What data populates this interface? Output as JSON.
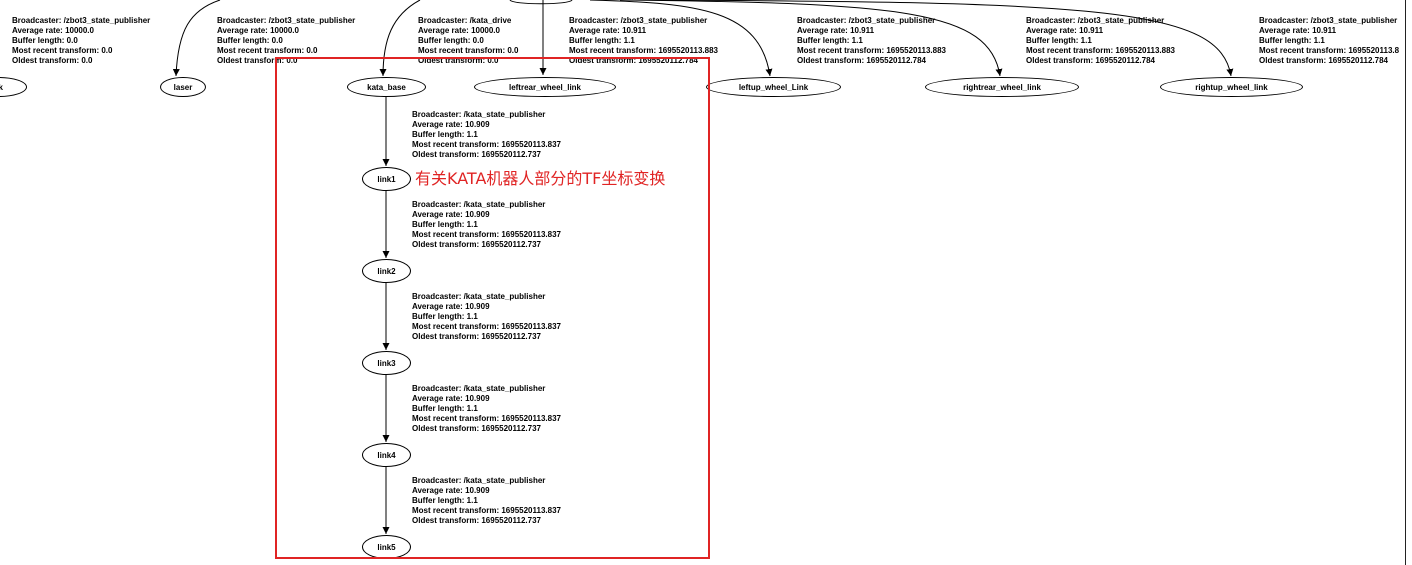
{
  "annotation": "有关KATA机器人部分的TF坐标变换",
  "top_row": {
    "labels": [
      {
        "broadcaster": "Broadcaster: /zbot3_state_publisher",
        "rate": "Average rate: 10000.0",
        "buffer": "Buffer length: 0.0",
        "recent": "Most recent transform: 0.0",
        "oldest": "Oldest transform: 0.0"
      },
      {
        "broadcaster": "Broadcaster: /zbot3_state_publisher",
        "rate": "Average rate: 10000.0",
        "buffer": "Buffer length: 0.0",
        "recent": "Most recent transform: 0.0",
        "oldest": "Oldest transform: 0.0"
      },
      {
        "broadcaster": "Broadcaster: /kata_drive",
        "rate": "Average rate: 10000.0",
        "buffer": "Buffer length: 0.0",
        "recent": "Most recent transform: 0.0",
        "oldest": "Oldest transform: 0.0"
      },
      {
        "broadcaster": "Broadcaster: /zbot3_state_publisher",
        "rate": "Average rate: 10.911",
        "buffer": "Buffer length: 1.1",
        "recent": "Most recent transform: 1695520113.883",
        "oldest": "Oldest transform: 1695520112.784"
      },
      {
        "broadcaster": "Broadcaster: /zbot3_state_publisher",
        "rate": "Average rate: 10.911",
        "buffer": "Buffer length: 1.1",
        "recent": "Most recent transform: 1695520113.883",
        "oldest": "Oldest transform: 1695520112.784"
      },
      {
        "broadcaster": "Broadcaster: /zbot3_state_publisher",
        "rate": "Average rate: 10.911",
        "buffer": "Buffer length: 1.1",
        "recent": "Most recent transform: 1695520113.883",
        "oldest": "Oldest transform: 1695520112.784"
      },
      {
        "broadcaster": "Broadcaster: /zbot3_state_publisher",
        "rate": "Average rate: 10.911",
        "buffer": "Buffer length: 1.1",
        "recent": "Most recent transform: 1695520113.8",
        "oldest": "Oldest transform: 1695520112.784"
      }
    ],
    "nodes": [
      "k",
      "laser",
      "kata_base",
      "leftrear_wheel_link",
      "leftup_wheel_Link",
      "rightrear_wheel_link",
      "rightup_wheel_link"
    ]
  },
  "chain": {
    "labels": [
      {
        "broadcaster": "Broadcaster: /kata_state_publisher",
        "rate": "Average rate: 10.909",
        "buffer": "Buffer length: 1.1",
        "recent": "Most recent transform: 1695520113.837",
        "oldest": "Oldest transform: 1695520112.737"
      },
      {
        "broadcaster": "Broadcaster: /kata_state_publisher",
        "rate": "Average rate: 10.909",
        "buffer": "Buffer length: 1.1",
        "recent": "Most recent transform: 1695520113.837",
        "oldest": "Oldest transform: 1695520112.737"
      },
      {
        "broadcaster": "Broadcaster: /kata_state_publisher",
        "rate": "Average rate: 10.909",
        "buffer": "Buffer length: 1.1",
        "recent": "Most recent transform: 1695520113.837",
        "oldest": "Oldest transform: 1695520112.737"
      },
      {
        "broadcaster": "Broadcaster: /kata_state_publisher",
        "rate": "Average rate: 10.909",
        "buffer": "Buffer length: 1.1",
        "recent": "Most recent transform: 1695520113.837",
        "oldest": "Oldest transform: 1695520112.737"
      },
      {
        "broadcaster": "Broadcaster: /kata_state_publisher",
        "rate": "Average rate: 10.909",
        "buffer": "Buffer length: 1.1",
        "recent": "Most recent transform: 1695520113.837",
        "oldest": "Oldest transform: 1695520112.737"
      }
    ],
    "nodes": [
      "link1",
      "link2",
      "link3",
      "link4",
      "link5"
    ]
  },
  "colors": {
    "highlight": "#e02424",
    "edge": "#000000"
  }
}
